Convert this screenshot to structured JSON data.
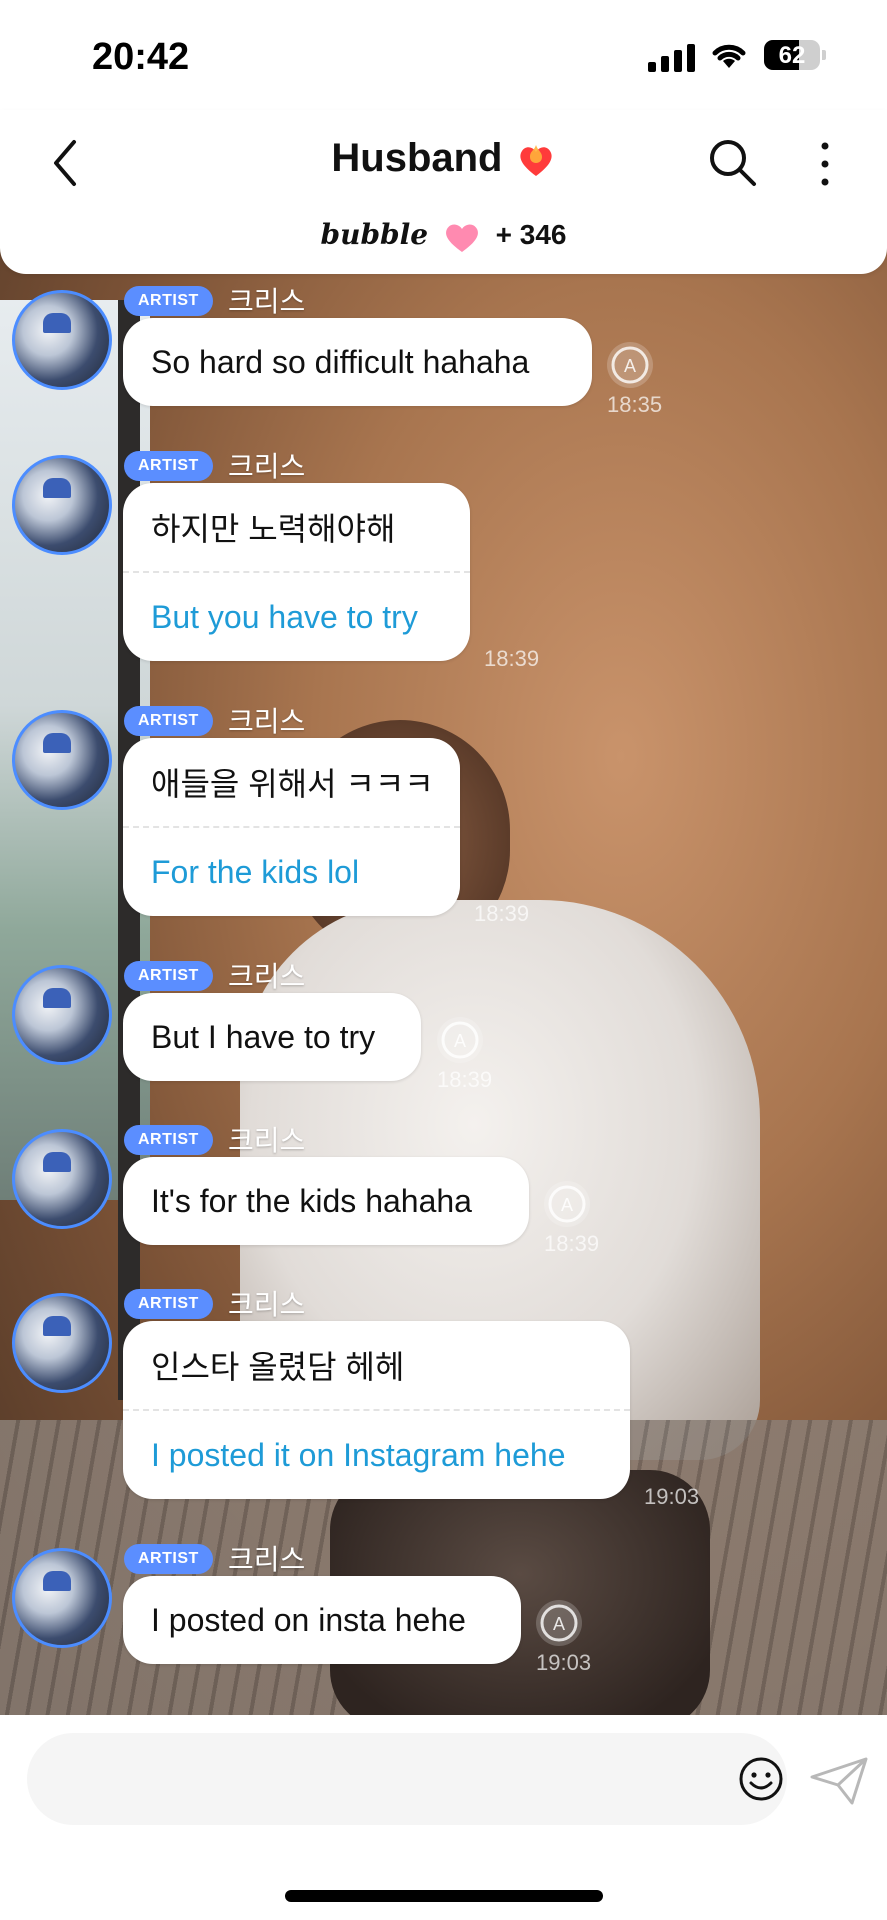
{
  "status_bar": {
    "time": "20:42",
    "battery": "62"
  },
  "header": {
    "title": "Husband",
    "brand": "bubble",
    "count": "+ 346"
  },
  "messages": [
    {
      "badge": "ARTIST",
      "sender": "크리스",
      "text": "So hard so difficult hahaha",
      "translation": "",
      "time": "18:35",
      "repost": true
    },
    {
      "badge": "ARTIST",
      "sender": "크리스",
      "text": "하지만 노력해야해",
      "translation": "But you have to try",
      "time": "18:39",
      "repost": false
    },
    {
      "badge": "ARTIST",
      "sender": "크리스",
      "text": "애들을 위해서 ㅋㅋㅋ",
      "translation": "For the kids lol",
      "time": "18:39",
      "repost": false
    },
    {
      "badge": "ARTIST",
      "sender": "크리스",
      "text": "But I have to try",
      "translation": "",
      "time": "18:39",
      "repost": true
    },
    {
      "badge": "ARTIST",
      "sender": "크리스",
      "text": "It's for the kids hahaha",
      "translation": "",
      "time": "18:39",
      "repost": true
    },
    {
      "badge": "ARTIST",
      "sender": "크리스",
      "text": "인스타 올렸담 헤헤",
      "translation": "I posted it on Instagram hehe",
      "time": "19:03",
      "repost": false
    },
    {
      "badge": "ARTIST",
      "sender": "크리스",
      "text": "I posted on insta hehe",
      "translation": "",
      "time": "19:03",
      "repost": true
    }
  ],
  "colors": {
    "badge": "#5b8eff",
    "translation": "#1e9bd7",
    "avatar_ring": "#4c8dff",
    "heart_pink": "#ff8ab0"
  },
  "icons": {
    "back": "chevron-left-icon",
    "search": "search-icon",
    "more": "more-vertical-icon",
    "emoji": "emoji-icon",
    "send": "send-icon",
    "repost": "auto-translate-icon"
  }
}
